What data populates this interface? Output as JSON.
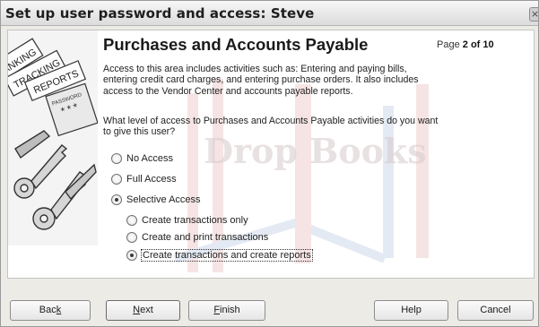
{
  "window": {
    "title": "Set up user password and access: Steve",
    "close_glyph": "×"
  },
  "illustration": {
    "words": [
      "BANKING",
      "TRACKING",
      "REPORTS",
      "PASSWORD"
    ],
    "stars": "***"
  },
  "watermark": {
    "text": "Drop Books"
  },
  "page": {
    "heading": "Purchases and Accounts Payable",
    "indicator_prefix": "Page",
    "indicator_value": "2 of 10",
    "description": "Access to this area includes activities such as: Entering and paying bills, entering credit card charges, and entering purchase orders. It also includes access to the Vendor Center and accounts payable reports.",
    "question": "What level of access to Purchases and Accounts Payable activities do you want to give this user?"
  },
  "access_options": [
    {
      "label": "No Access",
      "selected": false
    },
    {
      "label": "Full Access",
      "selected": false
    },
    {
      "label": "Selective Access",
      "selected": true
    }
  ],
  "selective_options": [
    {
      "label": "Create transactions only",
      "selected": false
    },
    {
      "label": "Create and print transactions",
      "selected": false
    },
    {
      "label": "Create transactions and create reports",
      "selected": true
    }
  ],
  "buttons": {
    "back": {
      "pre": "Bac",
      "key": "k",
      "post": ""
    },
    "next": {
      "pre": "",
      "key": "N",
      "post": "ext"
    },
    "finish": {
      "pre": "",
      "key": "F",
      "post": "inish"
    },
    "help": "Help",
    "cancel": "Cancel"
  }
}
